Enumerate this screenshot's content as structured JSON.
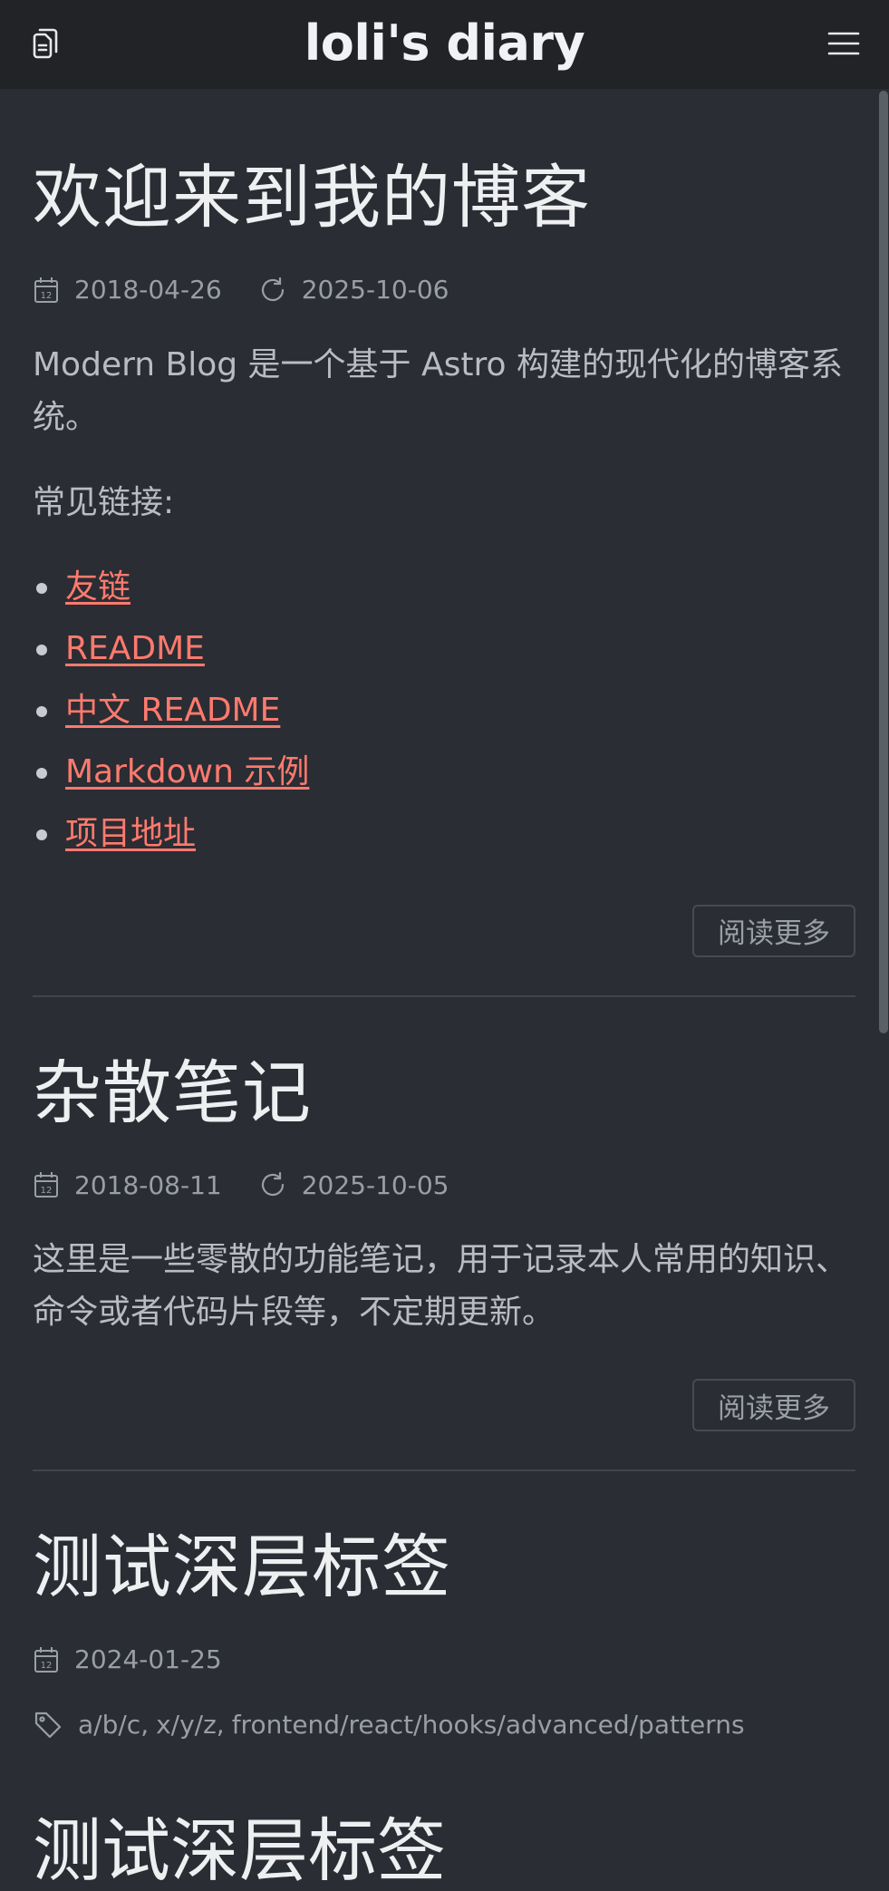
{
  "header": {
    "title": "loli's diary",
    "left_icon": "document-icon",
    "right_icon": "menu-icon"
  },
  "posts": [
    {
      "title": "欢迎来到我的博客",
      "published": "2018-04-26",
      "updated": "2025-10-06",
      "excerpt": "Modern Blog 是一个基于 Astro 构建的现代化的博客系统。",
      "subheading": "常见链接:",
      "links": [
        "友链",
        "README",
        "中文 README",
        "Markdown 示例",
        "项目地址"
      ],
      "more_label": "阅读更多"
    },
    {
      "title": "杂散笔记",
      "published": "2018-08-11",
      "updated": "2025-10-05",
      "excerpt": "这里是一些零散的功能笔记，用于记录本人常用的知识、命令或者代码片段等，不定期更新。",
      "more_label": "阅读更多"
    },
    {
      "title": "测试深层标签",
      "published": "2024-01-25",
      "tags": [
        "a/b/c,",
        "x/y/z,",
        "frontend/react/hooks/advanced/patterns"
      ]
    },
    {
      "title": "测试深层标签"
    }
  ],
  "colors": {
    "background": "#2a2d33",
    "header_bg": "#212327",
    "link": "#ff7a6e",
    "meta_text": "#9a9ea5"
  }
}
